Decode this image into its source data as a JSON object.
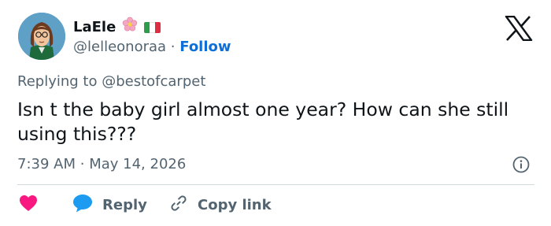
{
  "author": {
    "display_name": "LaEle",
    "name_emoji": "flower-emoji",
    "flag": "italy-flag",
    "handle": "@lelleonoraa",
    "separator": "·",
    "follow_label": "Follow"
  },
  "reply_context": {
    "text": "Replying to @bestofcarpet"
  },
  "tweet": {
    "text": "Isn t the baby girl almost one year? How can she still using this???",
    "time": "7:39 AM",
    "separator": "·",
    "date": "May 14, 2026"
  },
  "actions": {
    "like_icon": "heart-icon",
    "reply_label": "Reply",
    "copy_label": "Copy link"
  },
  "colors": {
    "accent": "#0f6fd6",
    "like": "#f91880",
    "reply_bubble": "#1d9bf0",
    "muted": "#536471",
    "text": "#0f1419",
    "divider": "#cfd9de"
  }
}
